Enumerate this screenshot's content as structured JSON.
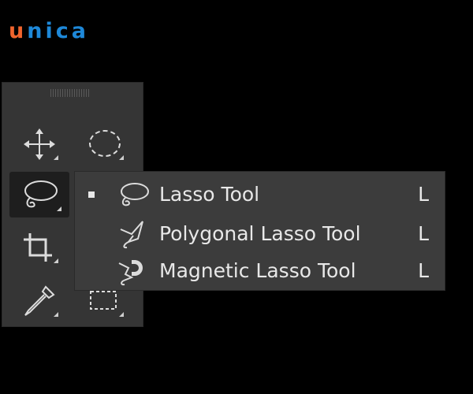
{
  "logo": {
    "first_letter": "u",
    "rest": "nica",
    "colors": {
      "first": "#f0642d",
      "rest": "#1e88d8"
    }
  },
  "toolbar": {
    "tools": [
      {
        "icon": "move-icon"
      },
      {
        "icon": "marquee-icon"
      },
      {
        "icon": "lasso-icon",
        "active": true
      },
      {
        "icon": "crop-icon"
      },
      {
        "icon": "eyedropper-icon"
      },
      {
        "icon": "frame-icon"
      }
    ]
  },
  "flyout": {
    "items": [
      {
        "label": "Lasso Tool",
        "shortcut": "L",
        "selected": true,
        "icon": "lasso-icon"
      },
      {
        "label": "Polygonal Lasso Tool",
        "shortcut": "L",
        "selected": false,
        "icon": "polygonal-lasso-icon"
      },
      {
        "label": "Magnetic Lasso Tool",
        "shortcut": "L",
        "selected": false,
        "icon": "magnetic-lasso-icon"
      }
    ]
  },
  "colors": {
    "background": "#000000",
    "panel": "#353535",
    "flyout": "#3c3c3c",
    "text": "#e8e8e8"
  }
}
